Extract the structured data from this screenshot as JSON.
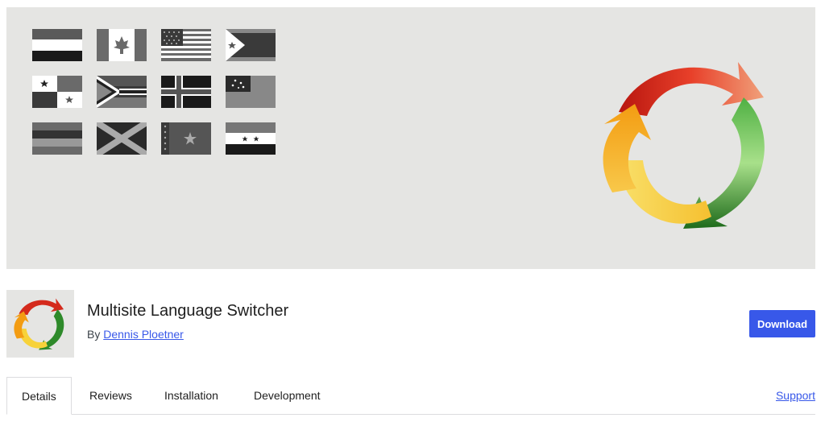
{
  "banner": {
    "flags": [
      "flag-row1-col1",
      "flag-row1-col2",
      "flag-row1-col3",
      "flag-row1-col4",
      "flag-row2-col1",
      "flag-row2-col2",
      "flag-row2-col3",
      "flag-row2-col4",
      "flag-row3-col1",
      "flag-row3-col2",
      "flag-row3-col3",
      "flag-row3-col4"
    ],
    "logo_icon": "circular-arrows-logo"
  },
  "plugin": {
    "title": "Multisite Language Switcher",
    "by_prefix": "By",
    "author": "Dennis Ploetner",
    "download_label": "Download"
  },
  "tabs": [
    {
      "label": "Details",
      "active": true
    },
    {
      "label": "Reviews",
      "active": false
    },
    {
      "label": "Installation",
      "active": false
    },
    {
      "label": "Development",
      "active": false
    }
  ],
  "support_label": "Support",
  "colors": {
    "accent": "#3858e9",
    "banner_bg": "#e5e5e3",
    "arrow_red": "#d42a1c",
    "arrow_green": "#2e8a2a",
    "arrow_orange": "#f39c12",
    "arrow_yellow": "#f7d23a"
  }
}
